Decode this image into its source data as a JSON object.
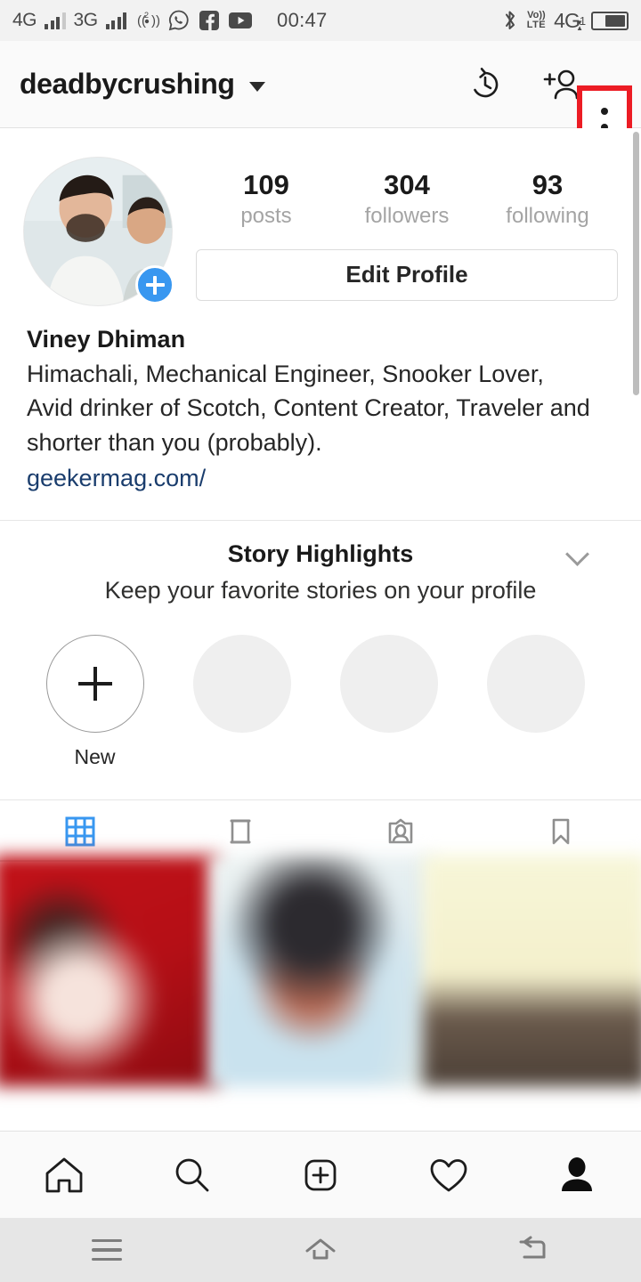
{
  "statusbar": {
    "network_primary": "4G",
    "network_secondary": "3G",
    "hotspot_icon": "hotspot-icon",
    "whatsapp_icon": "whatsapp-icon",
    "facebook_icon": "facebook-icon",
    "youtube_icon": "youtube-icon",
    "clock": "00:47",
    "bluetooth_icon": "bluetooth-icon",
    "volte_top": "Vo))",
    "volte_bottom": "LTE",
    "data_network": "4G",
    "sim_index": "1",
    "battery_icon": "battery-icon"
  },
  "appbar": {
    "username": "deadbycrushing",
    "dropdown_icon": "chevron-down-icon",
    "archive_icon": "clock-history-icon",
    "discover_people_icon": "add-person-icon",
    "overflow_icon": "three-dot-menu-icon",
    "highlight_color": "#ec1c24"
  },
  "profile": {
    "avatar_icon": "profile-avatar",
    "add_story_icon": "plus-icon",
    "stats": [
      {
        "num": "109",
        "label": "posts"
      },
      {
        "num": "304",
        "label": "followers"
      },
      {
        "num": "93",
        "label": "following"
      }
    ],
    "edit_profile_label": "Edit Profile",
    "fullname": "Viney Dhiman",
    "bio_line_1": "Himachali, Mechanical Engineer, Snooker Lover,",
    "bio_line_2": "Avid drinker of Scotch, Content Creator, Traveler and",
    "bio_line_3": "shorter than you (probably).",
    "website": "geekermag.com/",
    "link_color": "#1a3d6d"
  },
  "highlights": {
    "title": "Story Highlights",
    "subtitle": "Keep your favorite stories on your profile",
    "collapse_icon": "chevron-down-icon",
    "items": [
      {
        "label": "New",
        "type": "new"
      },
      {
        "label": "",
        "type": "placeholder"
      },
      {
        "label": "",
        "type": "placeholder"
      },
      {
        "label": "",
        "type": "placeholder"
      }
    ]
  },
  "tabs": [
    {
      "name": "grid-tab",
      "icon": "grid-icon",
      "active": true,
      "active_color": "#3897f0"
    },
    {
      "name": "reels-tab",
      "icon": "reels-icon",
      "active": false
    },
    {
      "name": "tagged-tab",
      "icon": "tagged-person-icon",
      "active": false
    },
    {
      "name": "saved-tab",
      "icon": "bookmark-icon",
      "active": false
    }
  ],
  "posts": [
    {
      "name": "post-thumbnail-1"
    },
    {
      "name": "post-thumbnail-2"
    },
    {
      "name": "post-thumbnail-3"
    }
  ],
  "bottomnav": [
    {
      "name": "nav-home",
      "icon": "home-icon",
      "active": false
    },
    {
      "name": "nav-search",
      "icon": "search-icon",
      "active": false
    },
    {
      "name": "nav-create",
      "icon": "plus-square-icon",
      "active": false
    },
    {
      "name": "nav-activity",
      "icon": "heart-icon",
      "active": false
    },
    {
      "name": "nav-profile",
      "icon": "person-filled-icon",
      "active": true
    }
  ],
  "androidnav": [
    {
      "name": "android-recents-button",
      "icon": "hamburger-icon"
    },
    {
      "name": "android-home-button",
      "icon": "home-outline-icon"
    },
    {
      "name": "android-back-button",
      "icon": "back-arrow-icon"
    }
  ]
}
